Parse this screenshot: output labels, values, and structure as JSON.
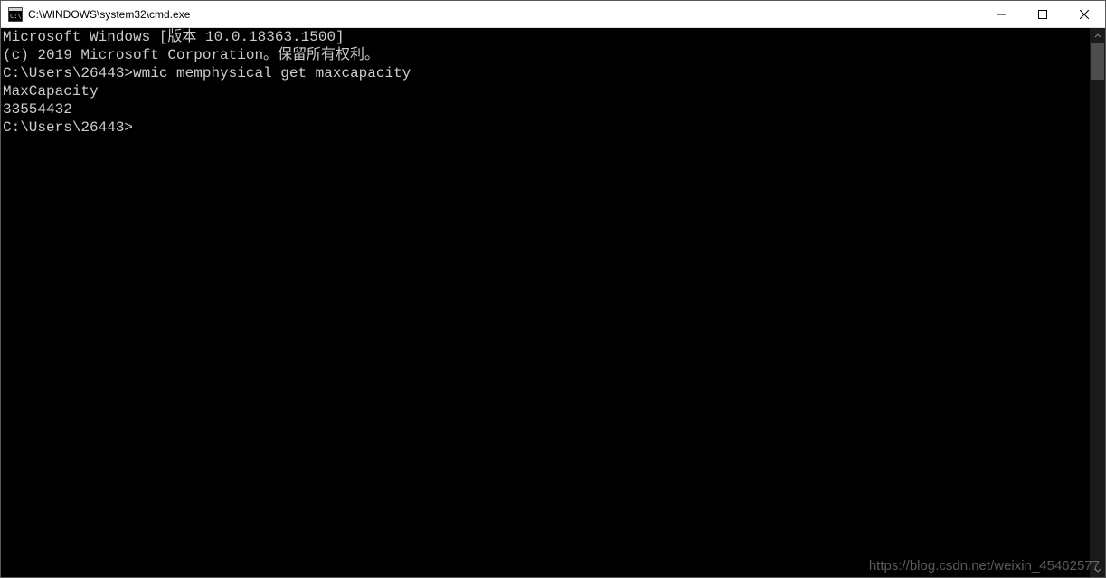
{
  "titlebar": {
    "title": "C:\\WINDOWS\\system32\\cmd.exe"
  },
  "console": {
    "header_line1": "Microsoft Windows [版本 10.0.18363.1500]",
    "header_line2": "(c) 2019 Microsoft Corporation。保留所有权利。",
    "blank": "",
    "prompt1_path": "C:\\Users\\26443>",
    "prompt1_cmd": "wmic memphysical get maxcapacity",
    "output_header": "MaxCapacity",
    "output_value": "33554432",
    "prompt2_path": "C:\\Users\\26443>"
  },
  "watermark": "https://blog.csdn.net/weixin_45462577"
}
